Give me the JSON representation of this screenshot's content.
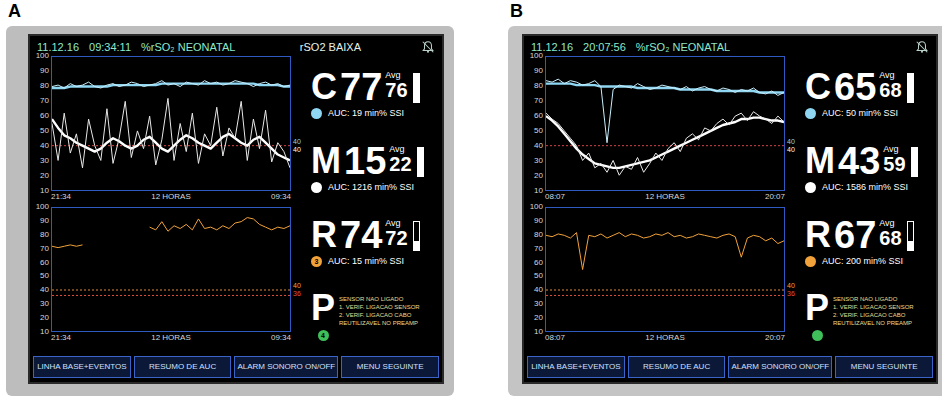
{
  "panels": [
    {
      "label": "A",
      "header": {
        "date": "11.12.16",
        "time": "09:34:11",
        "mode": "%rSO₂ NEONATAL",
        "alert": "rSO2 BAIXA"
      },
      "top_chart": {
        "y_ticks": [
          "100",
          "90",
          "80",
          "70",
          "60",
          "50",
          "40",
          "30",
          "20",
          "10"
        ],
        "x_labels": [
          "21:34",
          "12 HORAS",
          "09:34"
        ],
        "threshold_lines": [
          {
            "value": 40,
            "color": "#d94040"
          }
        ],
        "threshold_labels": [
          {
            "label": "40",
            "color": "#8fd6f2"
          },
          {
            "label": "40",
            "color": "#ffffff"
          }
        ],
        "series": [
          {
            "name": "C",
            "kind": "trend",
            "color": "#8fd6f2",
            "values": [
              79,
              79,
              79,
              80,
              80,
              80,
              80,
              80,
              80,
              80,
              81,
              81,
              81,
              81,
              81,
              81,
              81,
              81,
              82,
              82,
              82,
              82,
              82,
              82,
              82,
              82,
              82,
              82,
              82,
              82,
              82,
              82,
              82,
              82,
              81,
              81,
              81,
              81,
              80,
              80
            ]
          },
          {
            "name": "C",
            "kind": "raw",
            "color": "#c8eefc",
            "values": [
              80,
              81,
              79,
              82,
              80,
              81,
              83,
              80,
              79,
              81,
              82,
              80,
              81,
              83,
              82,
              80,
              81,
              82,
              84,
              81,
              82,
              80,
              83,
              82,
              81,
              84,
              82,
              83,
              81,
              82,
              84,
              83,
              82,
              80,
              82,
              83,
              81,
              82,
              80,
              81
            ]
          },
          {
            "name": "M",
            "kind": "trend",
            "color": "#ffffff",
            "values": [
              58,
              52,
              47,
              45,
              42,
              40,
              38,
              36,
              38,
              42,
              45,
              43,
              40,
              38,
              40,
              44,
              46,
              42,
              38,
              36,
              40,
              44,
              47,
              45,
              42,
              40,
              38,
              42,
              46,
              48,
              45,
              42,
              40,
              44,
              46,
              42,
              38,
              34,
              32,
              30
            ]
          },
          {
            "name": "M",
            "kind": "raw",
            "color": "#e8e8e8",
            "values": [
              55,
              30,
              62,
              35,
              48,
              25,
              58,
              40,
              30,
              65,
              28,
              45,
              70,
              32,
              50,
              38,
              60,
              27,
              44,
              72,
              30,
              55,
              36,
              62,
              28,
              48,
              40,
              66,
              33,
              52,
              45,
              70,
              30,
              58,
              38,
              64,
              29,
              42,
              36,
              25
            ]
          }
        ]
      },
      "bottom_chart": {
        "y_ticks": [
          "100",
          "90",
          "80",
          "70",
          "60",
          "50",
          "40",
          "30",
          "20",
          "10"
        ],
        "x_labels": [
          "21:34",
          "12 HORAS",
          "09:34"
        ],
        "threshold_lines": [
          {
            "value": 40,
            "color": "#e08a3a"
          },
          {
            "value": 36,
            "color": "#e0503a"
          }
        ],
        "threshold_labels": [
          {
            "label": "40",
            "color": "#f2a23a"
          },
          {
            "label": "36",
            "color": "#e0503a"
          }
        ],
        "series": [
          {
            "name": "R",
            "kind": "raw",
            "color": "#f2a23a",
            "values": [
              72,
              71,
              72,
              73,
              72,
              73,
              null,
              null,
              null,
              null,
              null,
              null,
              null,
              null,
              null,
              null,
              86,
              84,
              90,
              83,
              87,
              85,
              88,
              84,
              92,
              85,
              86,
              84,
              87,
              85,
              89,
              90,
              93,
              92,
              88,
              86,
              84,
              86,
              85,
              87
            ]
          }
        ]
      },
      "channels": [
        {
          "kind": "reading",
          "letter": "C",
          "value": "77",
          "avg_label": "Avg",
          "avg": "76",
          "auc": "AUC: 19 min% SSI",
          "color": "#8fd6f2",
          "level": 1
        },
        {
          "kind": "reading",
          "letter": "M",
          "value": "15",
          "avg_label": "Avg",
          "avg": "22",
          "auc": "AUC: 1216 min% SSI",
          "color": "#ffffff",
          "level": 1
        },
        {
          "kind": "reading",
          "letter": "R",
          "value": "74",
          "avg_label": "Avg",
          "avg": "72",
          "auc": "AUC: 15 min% SSI",
          "color": "#f2a23a",
          "dot_label": "3",
          "level": 0.3
        },
        {
          "kind": "message",
          "letter": "P",
          "color": "#3fbf5a",
          "dot_label": "4",
          "lines": [
            "SENSOR NAO LIGADO",
            "1. VERIF. LIGACAO SENSOR",
            "2. VERIF. LIGACAO CABO",
            "REUTILIZAVEL NO PREAMP"
          ]
        }
      ],
      "buttons": [
        "LINHA BASE+EVENTOS",
        "RESUMO DE AUC",
        "ALARM SONORO ON/OFF",
        "MENU SEGUINTE"
      ]
    },
    {
      "label": "B",
      "header": {
        "date": "11.12.16",
        "time": "20:07:56",
        "mode": "%rSO₂ NEONATAL"
      },
      "top_chart": {
        "y_ticks": [
          "100",
          "90",
          "80",
          "70",
          "60",
          "50",
          "40",
          "30",
          "20",
          "10"
        ],
        "x_labels": [
          "08:07",
          "12 HORAS",
          "20:07"
        ],
        "threshold_lines": [
          {
            "value": 40,
            "color": "#d94040"
          }
        ],
        "threshold_labels": [
          {
            "label": "40",
            "color": "#8fd6f2"
          },
          {
            "label": "40",
            "color": "#ffffff"
          }
        ],
        "series": [
          {
            "name": "C",
            "kind": "trend",
            "color": "#8fd6f2",
            "values": [
              82,
              82,
              82,
              82,
              82,
              81,
              81,
              81,
              81,
              80,
              80,
              80,
              80,
              80,
              80,
              79,
              79,
              79,
              79,
              79,
              79,
              79,
              78,
              78,
              78,
              78,
              78,
              78,
              77,
              77,
              77,
              77,
              77,
              77,
              77,
              76,
              76,
              76,
              76,
              76
            ]
          },
          {
            "name": "C",
            "kind": "raw",
            "color": "#c8eefc",
            "values": [
              84,
              83,
              85,
              82,
              84,
              83,
              81,
              82,
              84,
              80,
              42,
              78,
              81,
              80,
              79,
              82,
              80,
              78,
              79,
              81,
              80,
              79,
              78,
              80,
              77,
              79,
              80,
              78,
              77,
              79,
              78,
              76,
              78,
              77,
              79,
              76,
              75,
              77,
              74,
              76
            ]
          },
          {
            "name": "M",
            "kind": "trend",
            "color": "#ffffff",
            "values": [
              60,
              57,
              53,
              48,
              43,
              38,
              34,
              31,
              28,
              27,
              26,
              25,
              25,
              26,
              27,
              28,
              29,
              30,
              32,
              34,
              36,
              38,
              40,
              42,
              44,
              46,
              48,
              50,
              52,
              54,
              55,
              56,
              58,
              58,
              59,
              59,
              58,
              57,
              57,
              56
            ]
          },
          {
            "name": "M",
            "kind": "raw",
            "color": "#e8e8e8",
            "values": [
              62,
              58,
              55,
              50,
              45,
              40,
              30,
              35,
              25,
              28,
              22,
              30,
              20,
              26,
              24,
              32,
              22,
              28,
              35,
              30,
              38,
              42,
              36,
              45,
              48,
              44,
              52,
              50,
              55,
              58,
              54,
              60,
              62,
              57,
              63,
              60,
              58,
              55,
              60,
              56
            ]
          }
        ]
      },
      "bottom_chart": {
        "y_ticks": [
          "100",
          "90",
          "80",
          "70",
          "60",
          "50",
          "40",
          "30",
          "20",
          "10"
        ],
        "x_labels": [
          "08:07",
          "12 HORAS",
          "20:07"
        ],
        "threshold_lines": [
          {
            "value": 40,
            "color": "#e08a3a"
          },
          {
            "value": 36,
            "color": "#e0503a"
          }
        ],
        "threshold_labels": [
          {
            "label": "40",
            "color": "#f2a23a"
          },
          {
            "label": "36",
            "color": "#e0503a"
          }
        ],
        "series": [
          {
            "name": "R",
            "kind": "raw",
            "color": "#f2a23a",
            "values": [
              80,
              79,
              81,
              80,
              78,
              82,
              55,
              80,
              79,
              81,
              78,
              80,
              82,
              79,
              81,
              80,
              78,
              79,
              81,
              80,
              82,
              79,
              80,
              78,
              79,
              81,
              80,
              79,
              78,
              80,
              81,
              79,
              64,
              78,
              80,
              79,
              76,
              78,
              74,
              76
            ]
          }
        ]
      },
      "channels": [
        {
          "kind": "reading",
          "letter": "C",
          "value": "65",
          "avg_label": "Avg",
          "avg": "68",
          "auc": "AUC: 50 min% SSI",
          "color": "#8fd6f2",
          "level": 1
        },
        {
          "kind": "reading",
          "letter": "M",
          "value": "43",
          "avg_label": "Avg",
          "avg": "59",
          "auc": "AUC: 1586 min% SSI",
          "color": "#ffffff",
          "level": 1
        },
        {
          "kind": "reading",
          "letter": "R",
          "value": "67",
          "avg_label": "Avg",
          "avg": "68",
          "auc": "AUC: 200 min% SSI",
          "color": "#f2a23a",
          "level": 0.3
        },
        {
          "kind": "message",
          "letter": "P",
          "color": "#3fbf5a",
          "lines": [
            "SENSOR NAO LIGADO",
            "1. VERIF. LIGACAO SENSOR",
            "2. VERIF. LIGACAO CABO",
            "REUTILIZAVEL NO PREAMP"
          ]
        }
      ],
      "buttons": [
        "LINHA BASE+EVENTOS",
        "RESUMO DE AUC",
        "ALARM SONORO ON/OFF",
        "MENU SEGUINTE"
      ]
    }
  ]
}
